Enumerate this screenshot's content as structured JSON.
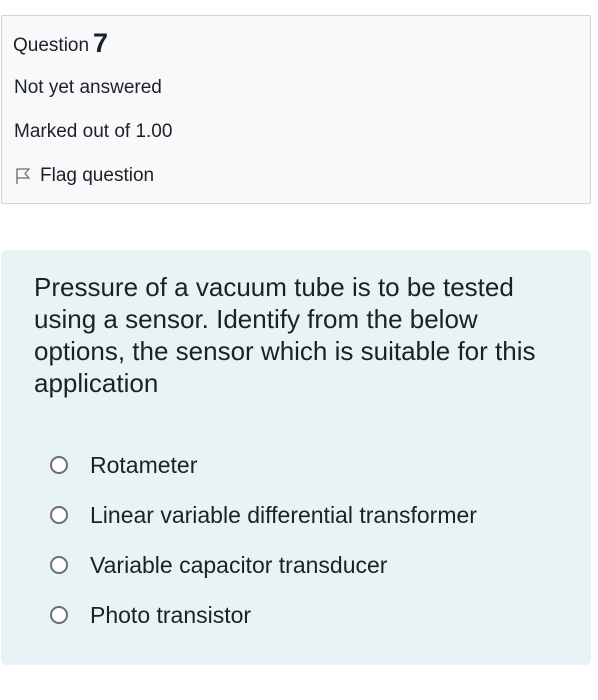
{
  "info": {
    "question_label": "Question",
    "question_number": "7",
    "state": "Not yet answered",
    "grade": "Marked out of 1.00",
    "flag_label": "Flag question"
  },
  "question": {
    "text": "Pressure of a vacuum tube is to be tested using a sensor. Identify from the below options, the sensor which is suitable for this application",
    "answers": [
      {
        "label": "Rotameter",
        "selected": false
      },
      {
        "label": "Linear variable differential transformer",
        "selected": false
      },
      {
        "label": "Variable capacitor transducer",
        "selected": false
      },
      {
        "label": "Photo transistor",
        "selected": false
      }
    ]
  },
  "icons": {
    "flag": "flag-outline-icon",
    "radio": "radio-unchecked-icon"
  },
  "colors": {
    "info_background": "#f8f9fa",
    "info_border": "#cfd4d9",
    "question_background": "#e7f3f5",
    "text": "#1d2125"
  }
}
